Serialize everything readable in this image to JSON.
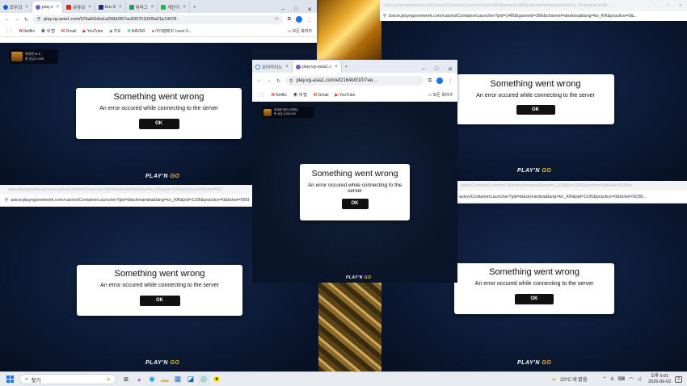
{
  "window_main": {
    "tabs": [
      {
        "label": "모두의"
      },
      {
        "label": "play.v"
      },
      {
        "label": "유튜브"
      },
      {
        "label": "bro.S"
      },
      {
        "label": "위라그"
      },
      {
        "label": "개인기"
      }
    ],
    "url": "play.vg-asia1.com/97ba81b6a1a258d2f57ac830751026fa21p19078"
  },
  "bookmarks": [
    "Netflix",
    "새 탭",
    "Gmail",
    "YouTube",
    "지도",
    "NAVER",
    "아이템매차 Level U...",
    "모든 북마크"
  ],
  "bookmarks_short": [
    "Netflix",
    "새 탭",
    "Gmail",
    "YouTube",
    "모든 북마크"
  ],
  "badge_text": "위대한 M 8",
  "badge_sub": "총 상금 0,000",
  "badge_small_title": "위대한 매진 (이벤트)",
  "badge_small_sub": "총 상금 0,000,000",
  "window_center": {
    "tabs": [
      {
        "label": "오어카지노"
      },
      {
        "label": "play.vg-asia1.c"
      }
    ],
    "url": "play.vg-asia1.com/ef2164b0f1f07ee..."
  },
  "url_top_right": "bsicw.playngonetwork.com/casino/ContainerLauncher?pid=1480&gameid=386&channel=desktop&lang=ko_KR&practice=0&...",
  "url_mid_left": "asicw.playngonetwork.com/casino/ContainerLauncher?gid=blackmamba&lang=ko_KR&pid=1195&practice=0&ticket=56f3",
  "url_mid_left_faded": "www.playngonetwork.com/casino/ContainerLauncher?gid=blackmamba&lang=ko_KR&pid=1195&practice=0&ticket=56f",
  "url_mid_right": "asino/ContainerLauncher?gid=blackmamba&lang=ko_KR&pid=1195&practice=0&ticket=9238...",
  "url_mid_right_faded": "asino/ContainerLauncher?pid=blackmamba&lang=ko_KR&pid=1195&practice=0&ticket=9238be...",
  "url_top_right_faded": "bsicw.playngonetwork.com/casino/ContainerLauncher?pid=1480&gameid=386&channel=desktop&lang=ko_KR&practice=0&...",
  "dialog": {
    "title": "Something went wrong",
    "message": "An error occured while connecting to the server",
    "ok": "OK"
  },
  "logo": {
    "prefix": "PLAY'N",
    "suffix": "GO"
  },
  "taskbar": {
    "search": "찾기",
    "weather": "20°C 네 맑음",
    "time": "오후 5:01",
    "date": "2025-06-02",
    "lang": "A",
    "notif": "2"
  },
  "colors": {
    "accent": "#1a73e8",
    "dialog_button": "#111111",
    "background": "#0c182f"
  }
}
